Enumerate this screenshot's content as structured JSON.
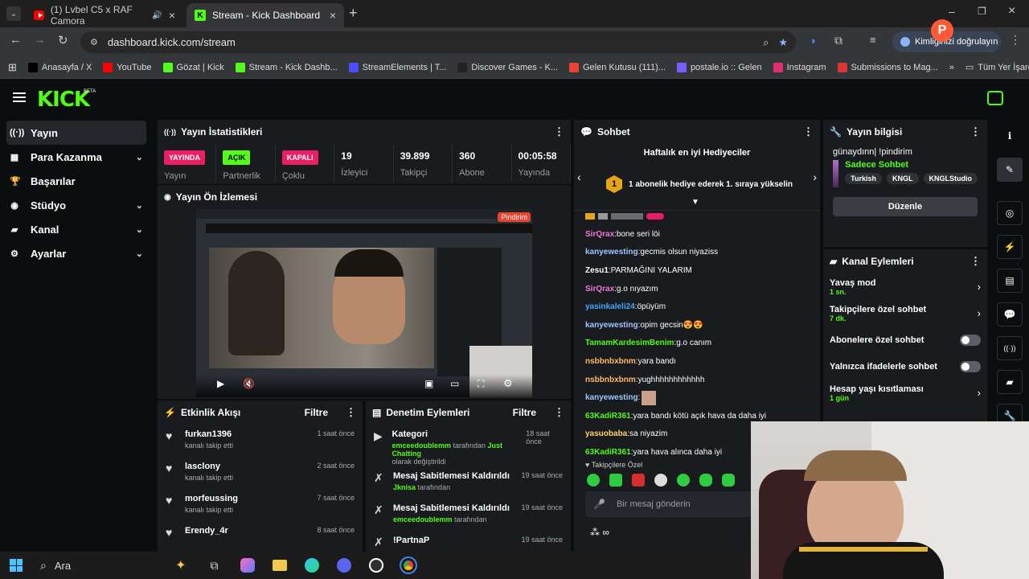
{
  "browser": {
    "tabs": [
      {
        "title": "(1) Lvbel C5 x RAF Camora",
        "active": false
      },
      {
        "title": "Stream - Kick Dashboard",
        "active": true
      }
    ],
    "url": "dashboard.kick.com/stream",
    "identity_label": "Kimliğinizi doğrulayın",
    "profile_initial": "P",
    "bookmarks": [
      {
        "label": "Anasayfa / X",
        "color": "#000000"
      },
      {
        "label": "YouTube",
        "color": "#ff0000"
      },
      {
        "label": "Gözat | Kick",
        "color": "#53fc18"
      },
      {
        "label": "Stream - Kick Dashb...",
        "color": "#53fc18"
      },
      {
        "label": "StreamElements | T...",
        "color": "#4b4bff"
      },
      {
        "label": "Discover Games - K...",
        "color": "#222222"
      },
      {
        "label": "Gelen Kutusu (111)...",
        "color": "#ea4335"
      },
      {
        "label": "postale.io :: Gelen",
        "color": "#7a5cff"
      },
      {
        "label": "Instagram",
        "color": "#e1306c"
      },
      {
        "label": "Submissions to Mag...",
        "color": "#d33"
      }
    ],
    "all_bookmarks": "Tüm Yer İşaretleri"
  },
  "kick": {
    "logo": "KICK",
    "beta": "BETA"
  },
  "sidebar": {
    "items": [
      {
        "label": "Yayın",
        "icon": "broadcast-icon",
        "glyph": "((·))",
        "active": true,
        "chevron": false
      },
      {
        "label": "Para Kazanma",
        "icon": "money-icon",
        "glyph": "▦",
        "active": false,
        "chevron": true
      },
      {
        "label": "Başarılar",
        "icon": "trophy-icon",
        "glyph": "🏆",
        "active": false,
        "chevron": false
      },
      {
        "label": "Stüdyo",
        "icon": "studio-icon",
        "glyph": "◉",
        "active": false,
        "chevron": true
      },
      {
        "label": "Kanal",
        "icon": "channel-icon",
        "glyph": "▰",
        "active": false,
        "chevron": true
      },
      {
        "label": "Ayarlar",
        "icon": "settings-icon",
        "glyph": "⚙",
        "active": false,
        "chevron": true
      }
    ]
  },
  "stats": {
    "title": "Yayın İstatistikleri",
    "cells": [
      {
        "badge": "YAYINDA",
        "badge_bg": "#e91e63",
        "badge_fg": "#ffffff",
        "sub": "Yayın"
      },
      {
        "badge": "AÇIK",
        "badge_bg": "#53fc18",
        "badge_fg": "#000000",
        "sub": "Partnerlik"
      },
      {
        "badge": "KAPALI",
        "badge_bg": "#e91e63",
        "badge_fg": "#ffffff",
        "sub": "Çoklu"
      },
      {
        "value": "19",
        "sub": "İzleyici"
      },
      {
        "value": "39.899",
        "sub": "Takipçi"
      },
      {
        "value": "360",
        "sub": "Abone"
      },
      {
        "value": "00:05:58",
        "sub": "Yayında"
      }
    ]
  },
  "preview": {
    "title": "Yayın Ön İzlemesi",
    "inner_badge": "Pindirim"
  },
  "activity": {
    "title": "Etkinlik Akışı",
    "filter": "Filtre",
    "items": [
      {
        "name": "furkan1396",
        "desc": "kanalı takip etti",
        "time": "1 saat önce"
      },
      {
        "name": "lasclony",
        "desc": "kanalı takip etti",
        "time": "2 saat önce"
      },
      {
        "name": "morfeussing",
        "desc": "kanalı takip etti",
        "time": "7 saat önce"
      },
      {
        "name": "Erendy_4r",
        "desc": "",
        "time": "8 saat önce"
      }
    ]
  },
  "moderation": {
    "title": "Denetim Eylemleri",
    "filter": "Filtre",
    "items": [
      {
        "title": "Kategori",
        "actor": "emceedoublemm",
        "mid": "tarafından",
        "target": "Just Chatting",
        "tail": "olarak değiştirildi",
        "time": "18 saat önce",
        "icon": "category-icon"
      },
      {
        "title": "Mesaj Sabitlemesi Kaldırıldı",
        "actor": "Jknisa",
        "mid": "tarafından",
        "target": "",
        "tail": "",
        "time": "19 saat önce",
        "icon": "unpin-icon"
      },
      {
        "title": "Mesaj Sabitlemesi Kaldırıldı",
        "actor": "emceedoublemm",
        "mid": "tarafından",
        "target": "",
        "tail": "",
        "time": "19 saat önce",
        "icon": "unpin-icon"
      },
      {
        "title": "!PartnaP",
        "actor": "",
        "mid": "",
        "target": "",
        "tail": "",
        "time": "19 saat önce",
        "icon": "unpin-icon"
      }
    ]
  },
  "chat": {
    "title": "Sohbet",
    "gifters_title": "Haftalık en iyi Hediyeciler",
    "gifters_rank": "1",
    "gifters_text": "1 abonelik hediye ederek 1. sıraya yükselin",
    "messages": [
      {
        "user": "SirQrax",
        "color": "#f07ad8",
        "text": "bone seri löi"
      },
      {
        "user": "kanyewesting",
        "color": "#9ec6ff",
        "text": "gecmis olsun niyaziss"
      },
      {
        "user": "Zesu1",
        "color": "#ffffff",
        "text": "PARMAĞINI YALARIM"
      },
      {
        "user": "SirQrax",
        "color": "#f07ad8",
        "text": "g.o nıyazım"
      },
      {
        "user": "yasinkaleli24",
        "color": "#3fa9ff",
        "text": "öpüyüm"
      },
      {
        "user": "kanyewesting",
        "color": "#9ec6ff",
        "text": "opim gecsin😍😍"
      },
      {
        "user": "TamamKardesimBenim",
        "color": "#53fc18",
        "text": "g.o canım"
      },
      {
        "user": "nsbbnbxbnm",
        "color": "#ffb86b",
        "text": "yara bandı"
      },
      {
        "user": "nsbbnbxbnm",
        "color": "#ffb86b",
        "text": "yughhhhhhhhhhhh"
      },
      {
        "user": "kanyewesting",
        "color": "#9ec6ff",
        "text": ""
      },
      {
        "user": "63KadiR361",
        "color": "#53fc18",
        "text": "yara bandı kötü açık hava da daha iyi"
      },
      {
        "user": "yasuobaba",
        "color": "#ffd36b",
        "text": "sa niyazim"
      },
      {
        "user": "63KadiR361",
        "color": "#53fc18",
        "text": "yara hava alınca daha iyi"
      }
    ],
    "follower_only": "Takipçilere Özel",
    "input_placeholder": "Bir mesaj gönderin"
  },
  "stream_info": {
    "title": "Yayın bilgisi",
    "stream_title": "günaydınn| !pindirim",
    "category": "Sadece Sohbet",
    "tags": [
      "Turkish",
      "KNGL",
      "KNGLStudio"
    ],
    "edit_button": "Düzenle"
  },
  "channel_actions": {
    "title": "Kanal Eylemleri",
    "rows": [
      {
        "label": "Yavaş mod",
        "sub": "1 sn.",
        "control": "chevron"
      },
      {
        "label": "Takipçilere özel sohbet",
        "sub": "7 dk.",
        "control": "chevron"
      },
      {
        "label": "Abonelere özel sohbet",
        "sub": "",
        "control": "toggle"
      },
      {
        "label": "Yalnızca ifadelerle sohbet",
        "sub": "",
        "control": "toggle"
      },
      {
        "label": "Hesap yaşı kısıtlaması",
        "sub": "1 gün",
        "control": "chevron"
      }
    ]
  },
  "taskbar": {
    "search_label": "Ara"
  }
}
